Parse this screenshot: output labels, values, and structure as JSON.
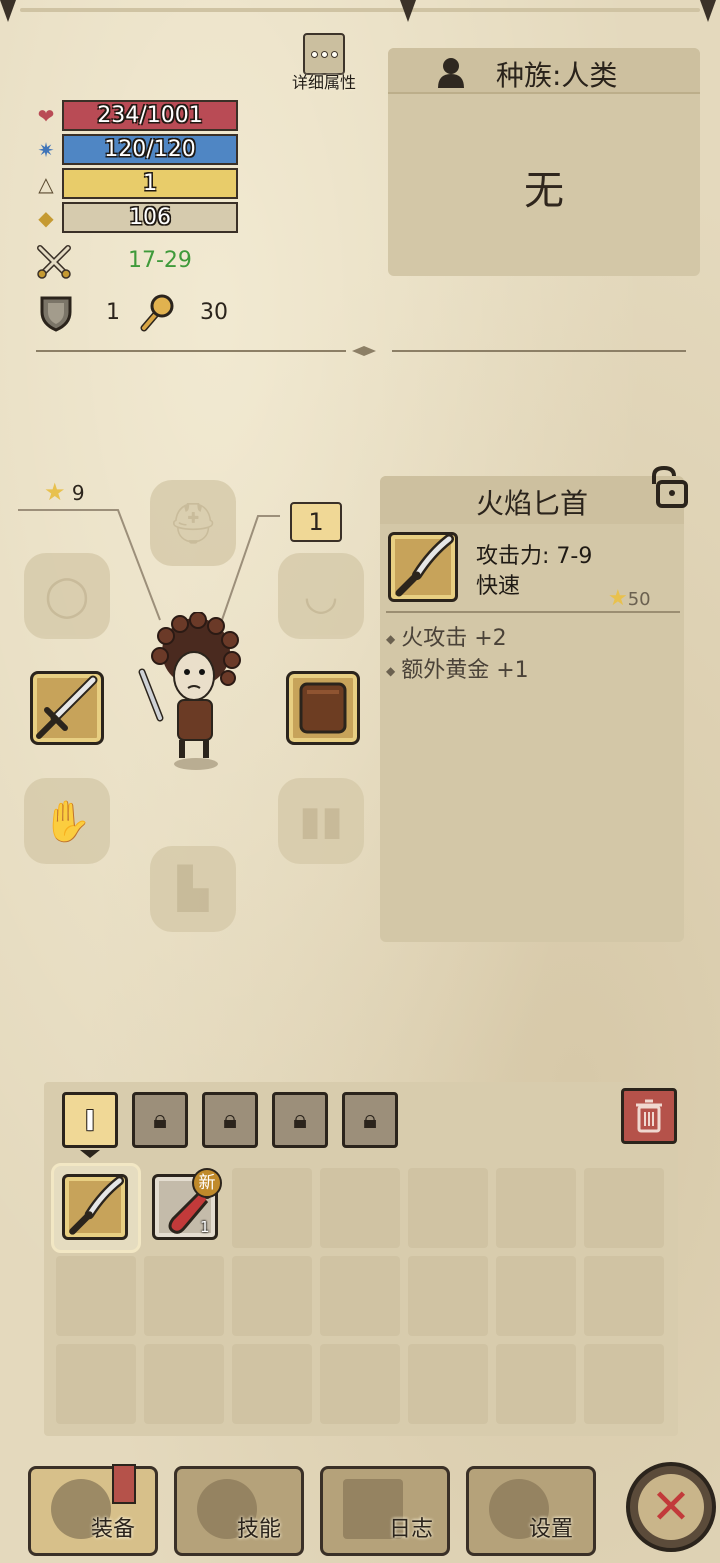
{
  "detail": {
    "label": "详细属性"
  },
  "stats": {
    "hp": "234/1001",
    "mana": "120/120",
    "level": "1",
    "gold": "106",
    "attack": "17-29",
    "defense": "1",
    "power": "30"
  },
  "race": {
    "label": "种族:人类",
    "value": "无"
  },
  "equipment": {
    "star_count": "9",
    "level_badge": "1"
  },
  "item": {
    "name": "火焰匕首",
    "attack": "攻击力: 7-9",
    "speed": "快速",
    "star_value": "50",
    "bonuses": [
      "火攻击 +2",
      "额外黄金 +1"
    ]
  },
  "inventory": {
    "active_tab": "I",
    "new_badge": "新",
    "potion_qty": "1"
  },
  "nav": {
    "equip": "装备",
    "skills": "技能",
    "log": "日志",
    "settings": "设置",
    "close": "✕"
  },
  "colors": {
    "hp": "#b94b55",
    "mana": "#4f86c4",
    "level": "#e8cc6a",
    "attack_text": "#3f9a3a"
  }
}
